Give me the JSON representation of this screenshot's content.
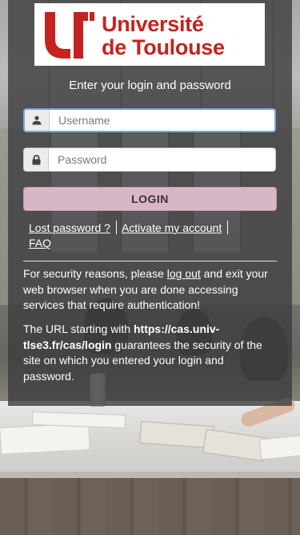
{
  "logo": {
    "line1": "Université",
    "line2": "de Toulouse"
  },
  "prompt": "Enter your login and password",
  "username": {
    "placeholder": "Username",
    "icon": "user-icon"
  },
  "password": {
    "placeholder": "Password",
    "icon": "lock-icon"
  },
  "login_label": "LOGIN",
  "links": {
    "lost_password": "Lost password ?",
    "activate_account": "Activate my account",
    "faq": "FAQ"
  },
  "security": {
    "before": "For security reasons, please ",
    "logout_link": "log out",
    "after": " and exit your web browser when you are done accessing services that require authentication!"
  },
  "url_notice": {
    "before": "The URL starting with ",
    "url": "https://cas.univ-tlse3.fr/cas/login",
    "after": " guarantees the security of the site on which you entered your login and password."
  },
  "colors": {
    "brand_red": "#c4231f",
    "login_button": "#d7b6c8",
    "panel_overlay": "rgba(60,60,62,0.80)"
  }
}
